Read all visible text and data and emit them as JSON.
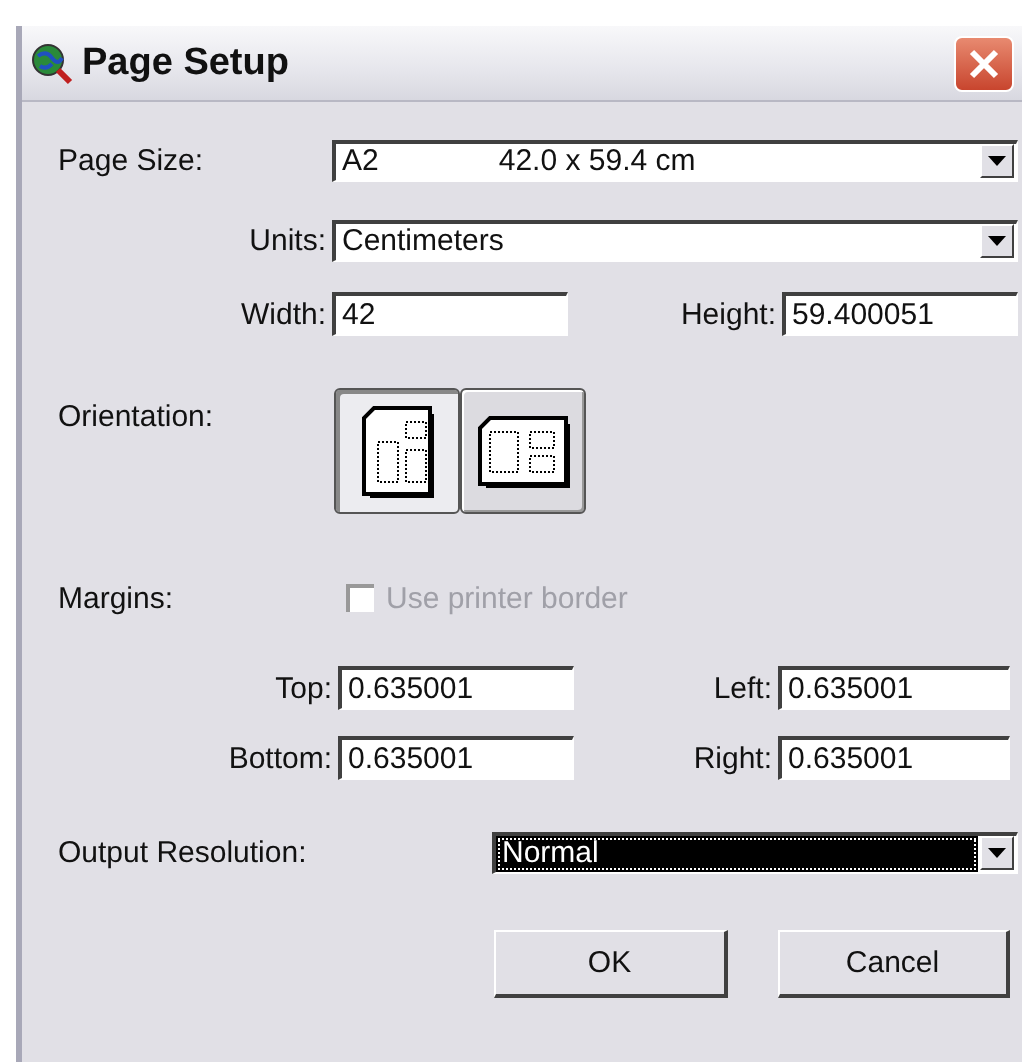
{
  "window": {
    "title": "Page Setup"
  },
  "page_size": {
    "label": "Page Size:",
    "name": "A2",
    "dimensions": "42.0 x 59.4 cm"
  },
  "units": {
    "label": "Units:",
    "value": "Centimeters"
  },
  "width": {
    "label": "Width:",
    "value": "42"
  },
  "height": {
    "label": "Height:",
    "value": "59.400051"
  },
  "orientation": {
    "label": "Orientation:",
    "options": [
      {
        "kind": "portrait",
        "selected": true
      },
      {
        "kind": "landscape",
        "selected": false
      }
    ]
  },
  "margins": {
    "label": "Margins:",
    "checkbox": {
      "label": "Use printer border",
      "checked": false,
      "disabled": true
    }
  },
  "margin_fields": [
    {
      "label": "Top:",
      "value": "0.635001"
    },
    {
      "label": "Left:",
      "value": "0.635001"
    },
    {
      "label": "Bottom:",
      "value": "0.635001"
    },
    {
      "label": "Right:",
      "value": "0.635001"
    }
  ],
  "output_resolution": {
    "label": "Output Resolution:",
    "value": "Normal",
    "focused": true
  },
  "buttons": [
    "OK",
    "Cancel"
  ]
}
